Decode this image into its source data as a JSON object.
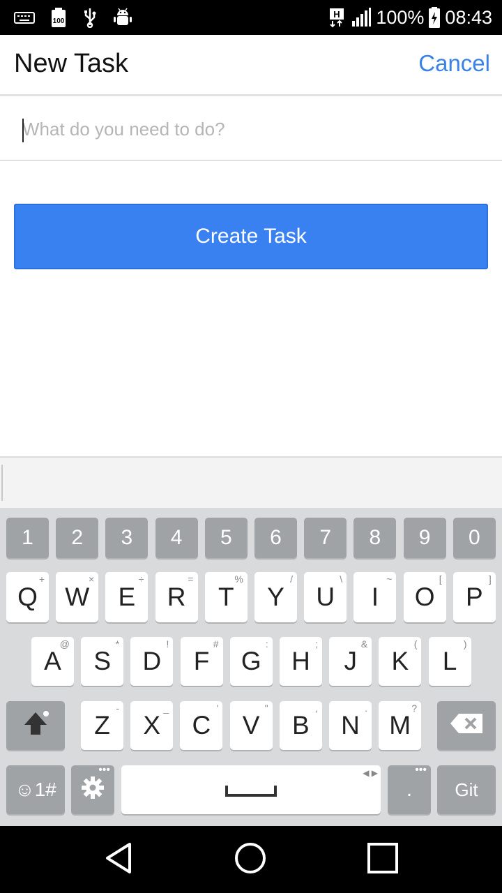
{
  "status_bar": {
    "icons_left": [
      "keyboard-icon",
      "battery-100-icon",
      "usb-icon",
      "android-debug-icon"
    ],
    "battery_100_label": "100",
    "network_label": "H",
    "battery_percent": "100%",
    "time": "08:43"
  },
  "header": {
    "title": "New Task",
    "cancel_label": "Cancel",
    "accent_color": "#3a82e8"
  },
  "task_input": {
    "placeholder": "What do you need to do?",
    "value": ""
  },
  "create_button": {
    "label": "Create Task",
    "color": "#3980f0"
  },
  "keyboard": {
    "number_row": [
      "1",
      "2",
      "3",
      "4",
      "5",
      "6",
      "7",
      "8",
      "9",
      "0"
    ],
    "row1": [
      {
        "key": "Q",
        "sub": "+"
      },
      {
        "key": "W",
        "sub": "×"
      },
      {
        "key": "E",
        "sub": "÷"
      },
      {
        "key": "R",
        "sub": "="
      },
      {
        "key": "T",
        "sub": "%"
      },
      {
        "key": "Y",
        "sub": "/"
      },
      {
        "key": "U",
        "sub": "\\"
      },
      {
        "key": "I",
        "sub": "~"
      },
      {
        "key": "O",
        "sub": "["
      },
      {
        "key": "P",
        "sub": "]"
      }
    ],
    "row2": [
      {
        "key": "A",
        "sub": "@"
      },
      {
        "key": "S",
        "sub": "*"
      },
      {
        "key": "D",
        "sub": "!"
      },
      {
        "key": "F",
        "sub": "#"
      },
      {
        "key": "G",
        "sub": ":"
      },
      {
        "key": "H",
        "sub": ";"
      },
      {
        "key": "J",
        "sub": "&"
      },
      {
        "key": "K",
        "sub": "("
      },
      {
        "key": "L",
        "sub": ")"
      }
    ],
    "row3": [
      {
        "key": "Z",
        "sub": "-"
      },
      {
        "key": "X",
        "sub": "_"
      },
      {
        "key": "C",
        "sub": "'"
      },
      {
        "key": "V",
        "sub": "\""
      },
      {
        "key": "B",
        "sub": ","
      },
      {
        "key": "N",
        "sub": "."
      },
      {
        "key": "M",
        "sub": "?"
      }
    ],
    "symbols_label": "☺1#",
    "period_label": ".",
    "git_label": "Git"
  },
  "nav_bar": {
    "icons": [
      "back-icon",
      "home-icon",
      "recents-icon"
    ]
  }
}
